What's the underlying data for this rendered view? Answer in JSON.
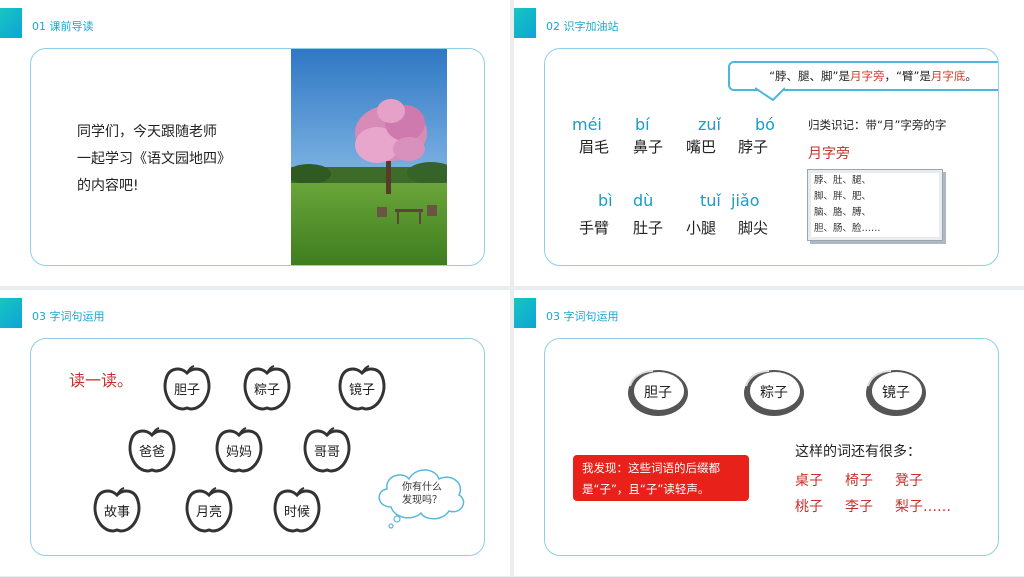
{
  "slide1": {
    "header": "01 课前导读",
    "intro_lines": [
      "同学们，今天跟随老师",
      "一起学习《语文园地四》",
      "的内容吧!"
    ]
  },
  "slide2": {
    "header": "02 识字加油站",
    "callout": {
      "part1": "“脖、腿、脚”是",
      "red1": "月字旁",
      "part2": "，“臂”是",
      "red2": "月字底",
      "part3": "。"
    },
    "row1": [
      {
        "pinyin": "méi",
        "word": "眉毛"
      },
      {
        "pinyin": "bí",
        "word": "鼻子"
      },
      {
        "pinyin": "zuǐ",
        "word": "嘴巴"
      },
      {
        "pinyin": "bó",
        "word": "脖子"
      }
    ],
    "row2": [
      {
        "pinyin": "bì",
        "word": "手臂"
      },
      {
        "pinyin": "dù",
        "word": "肚子"
      },
      {
        "pinyin": "tuǐ",
        "word": "小腿"
      },
      {
        "pinyin": "jiǎo",
        "word": "脚尖"
      }
    ],
    "classify": "归类识记：带“月”字旁的字",
    "radical": "月字旁",
    "box_lines": [
      "脖、肚、腿、",
      "脚、胖、肥、",
      "脑、胳、膊、",
      "胆、肠、脸……"
    ]
  },
  "slide3": {
    "header": "03 字词句运用",
    "title": "读一读。",
    "apples": [
      "胆子",
      "粽子",
      "镜子",
      "爸爸",
      "妈妈",
      "哥哥",
      "故事",
      "月亮",
      "时候"
    ],
    "cloud_lines": [
      "你有什么",
      "发现吗？"
    ]
  },
  "slide4": {
    "header": "03 字词句运用",
    "lemons": [
      "胆子",
      "粽子",
      "镜子"
    ],
    "finding_lines": [
      "我发现：这些词语的后缀都",
      "是“子”，且“子”读轻声。"
    ],
    "many_label": "这样的词还有很多：",
    "examples": [
      "桌子",
      "椅子",
      "凳子",
      "桃子",
      "李子",
      "梨子……"
    ]
  }
}
